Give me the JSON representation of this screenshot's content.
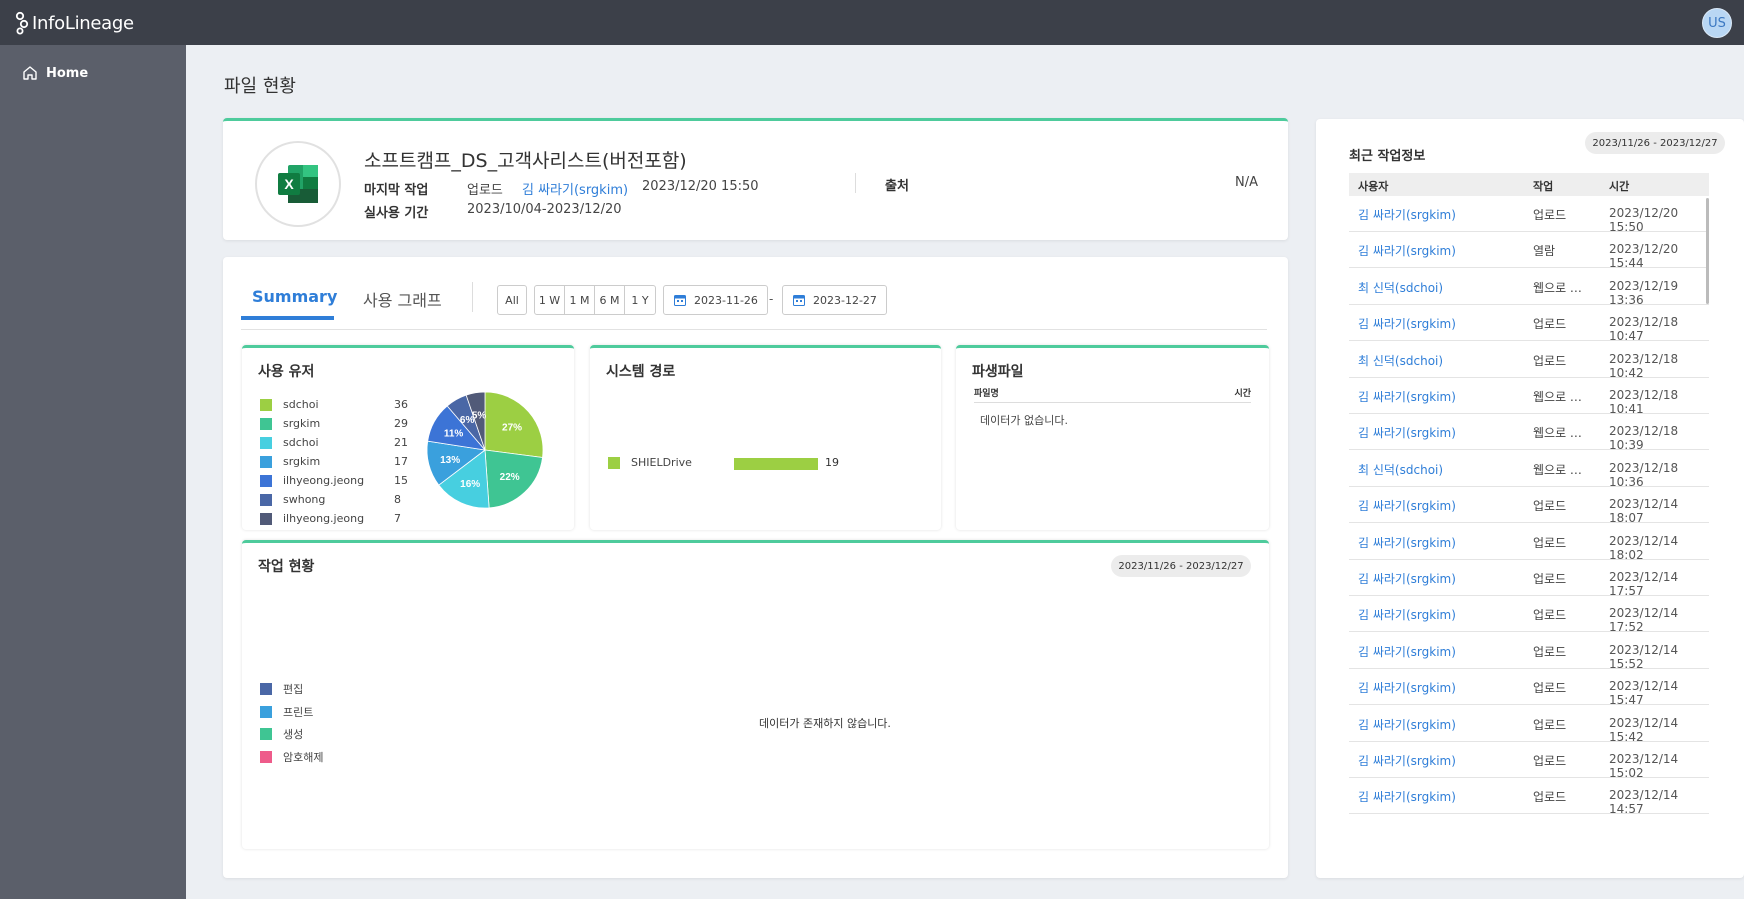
{
  "app": {
    "logo_text": "InfoLineage",
    "user_initials": "US"
  },
  "sidebar": {
    "items": [
      {
        "label": "Home",
        "icon": "home-icon"
      }
    ]
  },
  "page": {
    "title": "파일 현황"
  },
  "file": {
    "name": "소프트캠프_DS_고객사리스트(버전포함)",
    "last_action_label": "마지막 작업",
    "last_action": "업로드",
    "last_action_user": "김 싸라기(srgkim)",
    "last_action_time": "2023/12/20 15:50",
    "usage_period_label": "실사용 기간",
    "usage_period": "2023/10/04-2023/12/20",
    "source_label": "출처",
    "source_value": "N/A",
    "icon": "excel-icon"
  },
  "tabs": [
    {
      "label": "Summary",
      "active": true
    },
    {
      "label": "사용 그래프",
      "active": false
    }
  ],
  "period": {
    "all": "All",
    "options": [
      "1 W",
      "1 M",
      "6 M",
      "1 Y"
    ],
    "start_date": "2023-11-26",
    "end_date": "2023-12-27",
    "separator": "-"
  },
  "users_panel": {
    "title": "사용 유저",
    "legend": [
      {
        "name": "sdchoi",
        "count": "36",
        "color": "#9ccf43"
      },
      {
        "name": "srgkim",
        "count": "29",
        "color": "#3fc593"
      },
      {
        "name": "sdchoi",
        "count": "21",
        "color": "#47cfe0"
      },
      {
        "name": "srgkim",
        "count": "17",
        "color": "#3aa0dd"
      },
      {
        "name": "ilhyeong.jeong",
        "count": "15",
        "color": "#3c74d6"
      },
      {
        "name": "swhong",
        "count": "8",
        "color": "#4a67a6"
      },
      {
        "name": "ilhyeong.jeong",
        "count": "7",
        "color": "#515a78"
      }
    ]
  },
  "chart_data": {
    "type": "pie",
    "title": "사용 유저",
    "categories": [
      "sdchoi",
      "srgkim",
      "sdchoi",
      "srgkim",
      "ilhyeong.jeong",
      "swhong",
      "ilhyeong.jeong"
    ],
    "values": [
      36,
      29,
      21,
      17,
      15,
      8,
      7
    ],
    "slice_labels": [
      "27%",
      "22%",
      "16%",
      "13%",
      "11%",
      "6%",
      "5%"
    ],
    "colors": [
      "#9ccf43",
      "#3fc593",
      "#47cfe0",
      "#3aa0dd",
      "#3c74d6",
      "#4a67a6",
      "#515a78"
    ]
  },
  "system_path": {
    "title": "시스템 경로",
    "items": [
      {
        "name": "SHIELDrive",
        "value": 19,
        "value_label": "19",
        "color": "#9ccf43"
      }
    ]
  },
  "derived_files": {
    "title": "파생파일",
    "columns": [
      "파일명",
      "시간"
    ],
    "empty_text": "데이터가 없습니다."
  },
  "work_status": {
    "title": "작업 현황",
    "date_range": "2023/11/26 - 2023/12/27",
    "legend": [
      {
        "name": "편집",
        "color": "#4a67a6"
      },
      {
        "name": "프린트",
        "color": "#3aa0dd"
      },
      {
        "name": "생성",
        "color": "#3fc593"
      },
      {
        "name": "암호해제",
        "color": "#ee5b8a"
      }
    ],
    "empty_text": "데이터가 존재하지 않습니다."
  },
  "recent": {
    "title": "최근 작업정보",
    "date_range": "2023/11/26 - 2023/12/27",
    "columns": [
      "사용자",
      "작업",
      "시간"
    ],
    "rows": [
      {
        "user": "김 싸라기(srgkim)",
        "action": "업로드",
        "time": "2023/12/20 15:50"
      },
      {
        "user": "김 싸라기(srgkim)",
        "action": "열람",
        "time": "2023/12/20 15:44"
      },
      {
        "user": "최 신덕(sdchoi)",
        "action": "웹으로 …",
        "time": "2023/12/19 13:36"
      },
      {
        "user": "김 싸라기(srgkim)",
        "action": "업로드",
        "time": "2023/12/18 10:47"
      },
      {
        "user": "최 신덕(sdchoi)",
        "action": "업로드",
        "time": "2023/12/18 10:42"
      },
      {
        "user": "김 싸라기(srgkim)",
        "action": "웹으로 …",
        "time": "2023/12/18 10:41"
      },
      {
        "user": "김 싸라기(srgkim)",
        "action": "웹으로 …",
        "time": "2023/12/18 10:39"
      },
      {
        "user": "최 신덕(sdchoi)",
        "action": "웹으로 …",
        "time": "2023/12/18 10:36"
      },
      {
        "user": "김 싸라기(srgkim)",
        "action": "업로드",
        "time": "2023/12/14 18:07"
      },
      {
        "user": "김 싸라기(srgkim)",
        "action": "업로드",
        "time": "2023/12/14 18:02"
      },
      {
        "user": "김 싸라기(srgkim)",
        "action": "업로드",
        "time": "2023/12/14 17:57"
      },
      {
        "user": "김 싸라기(srgkim)",
        "action": "업로드",
        "time": "2023/12/14 17:52"
      },
      {
        "user": "김 싸라기(srgkim)",
        "action": "업로드",
        "time": "2023/12/14 15:52"
      },
      {
        "user": "김 싸라기(srgkim)",
        "action": "업로드",
        "time": "2023/12/14 15:47"
      },
      {
        "user": "김 싸라기(srgkim)",
        "action": "업로드",
        "time": "2023/12/14 15:42"
      },
      {
        "user": "김 싸라기(srgkim)",
        "action": "업로드",
        "time": "2023/12/14 15:02"
      },
      {
        "user": "김 싸라기(srgkim)",
        "action": "업로드",
        "time": "2023/12/14 14:57"
      }
    ]
  }
}
